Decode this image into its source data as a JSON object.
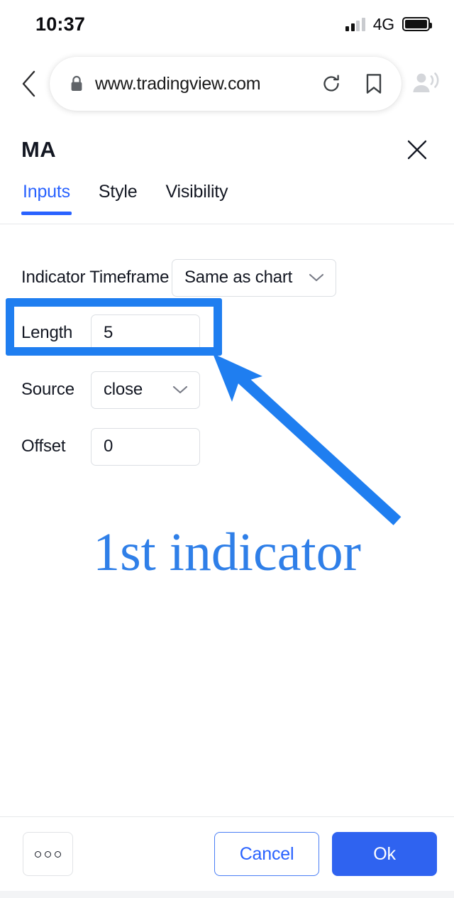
{
  "status_bar": {
    "time": "10:37",
    "network": "4G",
    "signal_icon": "signal-bars-icon",
    "battery_icon": "battery-full-icon"
  },
  "browser": {
    "back_icon": "chevron-left-icon",
    "lock_icon": "lock-icon",
    "url": "www.tradingview.com",
    "reload_icon": "reload-icon",
    "bookmark_icon": "bookmark-icon",
    "tabs_icon": "person-speaking-icon"
  },
  "dialog": {
    "title": "MA",
    "close_icon": "close-icon",
    "tabs": [
      {
        "label": "Inputs",
        "active": true
      },
      {
        "label": "Style",
        "active": false
      },
      {
        "label": "Visibility",
        "active": false
      }
    ],
    "fields": {
      "timeframe": {
        "label": "Indicator Timeframe",
        "value": "Same as chart",
        "chevron_icon": "chevron-down-icon"
      },
      "length": {
        "label": "Length",
        "value": "5"
      },
      "source": {
        "label": "Source",
        "value": "close",
        "chevron_icon": "chevron-down-icon"
      },
      "offset": {
        "label": "Offset",
        "value": "0"
      }
    }
  },
  "annotation": {
    "text": "1st indicator",
    "color": "#2f7fe8",
    "highlight_color": "#1f7ef0",
    "arrow_icon": "arrow-up-left-icon"
  },
  "footer": {
    "more_label": "",
    "more_icon": "ellipsis-icon",
    "cancel_label": "Cancel",
    "ok_label": "Ok"
  },
  "colors": {
    "accent_blue": "#2962ff",
    "ok_button_blue": "#2f63f0",
    "annotation_blue": "#1f7ef0",
    "text_primary": "#131722",
    "border": "#dcdfe3"
  }
}
